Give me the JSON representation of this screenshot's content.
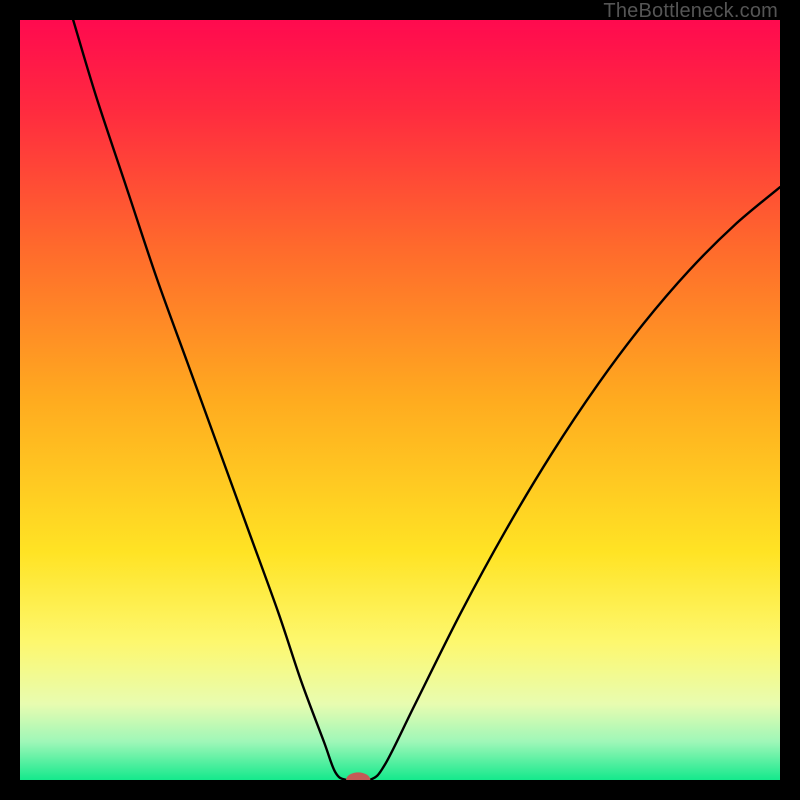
{
  "watermark": "TheBottleneck.com",
  "chart_data": {
    "type": "line",
    "title": "",
    "xlabel": "",
    "ylabel": "",
    "xlim": [
      0,
      100
    ],
    "ylim": [
      0,
      100
    ],
    "background_gradient": {
      "stops": [
        {
          "offset": 0.0,
          "color": "#ff0a4f"
        },
        {
          "offset": 0.12,
          "color": "#ff2b3f"
        },
        {
          "offset": 0.3,
          "color": "#ff6a2c"
        },
        {
          "offset": 0.5,
          "color": "#ffab1f"
        },
        {
          "offset": 0.7,
          "color": "#ffe324"
        },
        {
          "offset": 0.82,
          "color": "#fdf86f"
        },
        {
          "offset": 0.9,
          "color": "#e8fcb0"
        },
        {
          "offset": 0.95,
          "color": "#9ef7b8"
        },
        {
          "offset": 1.0,
          "color": "#14e98c"
        }
      ]
    },
    "series": [
      {
        "name": "bottleneck-curve",
        "stroke": "#000000",
        "stroke_width": 2.4,
        "points": [
          {
            "x": 7.0,
            "y": 100.0
          },
          {
            "x": 10.0,
            "y": 90.0
          },
          {
            "x": 14.0,
            "y": 78.0
          },
          {
            "x": 18.0,
            "y": 66.0
          },
          {
            "x": 22.0,
            "y": 55.0
          },
          {
            "x": 26.0,
            "y": 44.0
          },
          {
            "x": 30.0,
            "y": 33.0
          },
          {
            "x": 34.0,
            "y": 22.0
          },
          {
            "x": 37.0,
            "y": 13.0
          },
          {
            "x": 40.0,
            "y": 5.0
          },
          {
            "x": 41.5,
            "y": 1.0
          },
          {
            "x": 43.0,
            "y": 0.0
          },
          {
            "x": 46.0,
            "y": 0.0
          },
          {
            "x": 48.0,
            "y": 2.0
          },
          {
            "x": 52.0,
            "y": 10.0
          },
          {
            "x": 58.0,
            "y": 22.0
          },
          {
            "x": 64.0,
            "y": 33.0
          },
          {
            "x": 70.0,
            "y": 43.0
          },
          {
            "x": 76.0,
            "y": 52.0
          },
          {
            "x": 82.0,
            "y": 60.0
          },
          {
            "x": 88.0,
            "y": 67.0
          },
          {
            "x": 94.0,
            "y": 73.0
          },
          {
            "x": 100.0,
            "y": 78.0
          }
        ]
      }
    ],
    "marker": {
      "name": "optimal-point",
      "x": 44.5,
      "y": 0.0,
      "rx": 1.6,
      "ry": 1.0,
      "fill": "#c45a56"
    }
  }
}
